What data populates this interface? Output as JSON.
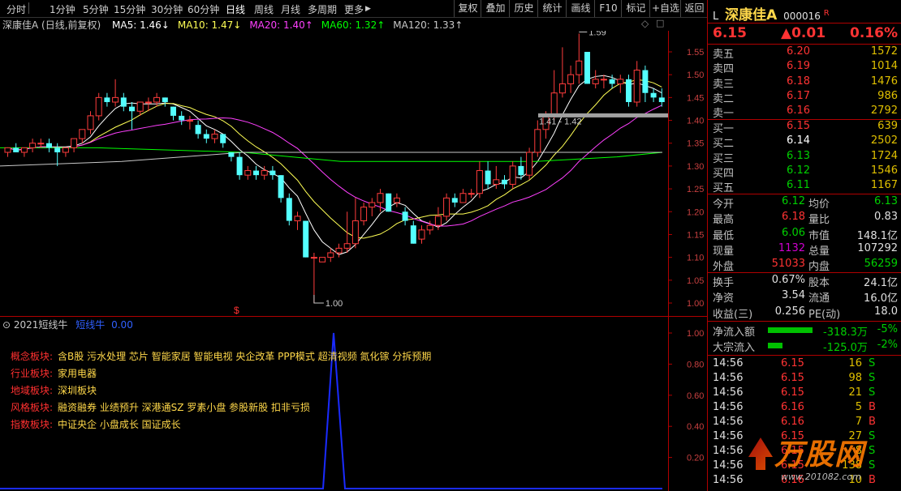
{
  "toolbar": {
    "periods": [
      "分时",
      "1分钟",
      "5分钟",
      "15分钟",
      "30分钟",
      "60分钟",
      "日线",
      "周线",
      "月线",
      "多周期",
      "更多"
    ],
    "active": "日线",
    "more_arrow": "▶",
    "buttons": [
      "复权",
      "叠加",
      "历史",
      "统计",
      "画线",
      "F10",
      "标记",
      "+自选",
      "返回"
    ]
  },
  "chart_header": {
    "title": "深康佳A (日线,前复权)",
    "ma": [
      {
        "label": "MA5: 1.46↓",
        "color": "#ffffff"
      },
      {
        "label": "MA10: 1.47↓",
        "color": "#ffff55"
      },
      {
        "label": "MA20: 1.40↑",
        "color": "#ff40ff"
      },
      {
        "label": "MA60: 1.32↑",
        "color": "#00ff00"
      },
      {
        "label": "MA120: 1.33↑",
        "color": "#c8c8c8"
      }
    ]
  },
  "chart_data": {
    "type": "candlestick",
    "ylim": [
      1.0,
      1.6
    ],
    "y_ticks": [
      "1.55",
      "1.50",
      "1.45",
      "1.40",
      "1.35",
      "1.30",
      "1.25",
      "1.20",
      "1.15",
      "1.10",
      "1.05",
      "1.00"
    ],
    "annotations": {
      "high": "1.59",
      "low": "1.00",
      "range": "1.41 - 1.42"
    },
    "marker": "$"
  },
  "indicator": {
    "title": "2021短线牛",
    "series_name": "短线牛",
    "value": "0.00",
    "y_ticks": [
      "1.00",
      "0.80",
      "0.60",
      "0.40",
      "0.20"
    ]
  },
  "info_lines": [
    {
      "key": "概念板块:",
      "value": "含B股 污水处理 芯片 智能家居 智能电视 央企改革 PPP模式 超清视频 氮化镓 分拆预期"
    },
    {
      "key": "行业板块:",
      "value": "家用电器"
    },
    {
      "key": "地域板块:",
      "value": "深圳板块"
    },
    {
      "key": "风格板块:",
      "value": "融资融券 业绩预升 深港通SZ 罗素小盘 参股新股 扣非亏损"
    },
    {
      "key": "指数板块:",
      "value": "中证央企 小盘成长 国证成长"
    }
  ],
  "quote": {
    "prefix": "L",
    "name": "深康佳A",
    "code": "000016",
    "suffix": "R",
    "price": "6.15",
    "change": "▲0.01",
    "pct": "0.16%",
    "asks": [
      {
        "label": "卖五",
        "price": "6.20",
        "vol": "1572"
      },
      {
        "label": "卖四",
        "price": "6.19",
        "vol": "1014"
      },
      {
        "label": "卖三",
        "price": "6.18",
        "vol": "1476"
      },
      {
        "label": "卖二",
        "price": "6.17",
        "vol": "986"
      },
      {
        "label": "卖一",
        "price": "6.16",
        "vol": "2792"
      }
    ],
    "bids": [
      {
        "label": "买一",
        "price": "6.15",
        "vol": "639"
      },
      {
        "label": "买二",
        "price": "6.14",
        "vol": "2502"
      },
      {
        "label": "买三",
        "price": "6.13",
        "vol": "1724"
      },
      {
        "label": "买四",
        "price": "6.12",
        "vol": "1546"
      },
      {
        "label": "买五",
        "price": "6.11",
        "vol": "1167"
      }
    ],
    "stats": [
      {
        "l1": "今开",
        "v1": "6.12",
        "l2": "均价",
        "v2": "6.13"
      },
      {
        "l1": "最高",
        "v1": "6.18",
        "l2": "量比",
        "v2": "0.83"
      },
      {
        "l1": "最低",
        "v1": "6.06",
        "l2": "市值",
        "v2": "148.1亿"
      },
      {
        "l1": "现量",
        "v1": "1132",
        "l2": "总量",
        "v2": "107292"
      },
      {
        "l1": "外盘",
        "v1": "51033",
        "l2": "内盘",
        "v2": "56259"
      }
    ],
    "stats2": [
      {
        "l1": "换手",
        "v1": "0.67%",
        "l2": "股本",
        "v2": "24.1亿"
      },
      {
        "l1": "净资",
        "v1": "3.54",
        "l2": "流通",
        "v2": "16.0亿"
      },
      {
        "l1": "收益(三)",
        "v1": "0.256",
        "l2": "PE(动)",
        "v2": "18.0"
      }
    ],
    "flows": [
      {
        "label": "净流入额",
        "value": "-318.3万",
        "pct": "-5%",
        "fill": 0.55
      },
      {
        "label": "大宗流入",
        "value": "-125.0万",
        "pct": "-2%",
        "fill": 0.18
      }
    ],
    "ticks": [
      {
        "time": "14:56",
        "price": "6.15",
        "vol": "16",
        "side": "S"
      },
      {
        "time": "14:56",
        "price": "6.15",
        "vol": "98",
        "side": "S"
      },
      {
        "time": "14:56",
        "price": "6.15",
        "vol": "21",
        "side": "S"
      },
      {
        "time": "14:56",
        "price": "6.16",
        "vol": "5",
        "side": "B"
      },
      {
        "time": "14:56",
        "price": "6.16",
        "vol": "7",
        "side": "B"
      },
      {
        "time": "14:56",
        "price": "6.15",
        "vol": "27",
        "side": "S"
      },
      {
        "time": "14:56",
        "price": "6.15",
        "vol": "8",
        "side": "S"
      },
      {
        "time": "14:56",
        "price": "6.15",
        "vol": "138",
        "side": "S"
      },
      {
        "time": "14:56",
        "price": "6.16",
        "vol": "10",
        "side": "B"
      }
    ]
  },
  "watermark": {
    "text": "万股网",
    "url": "www.201082.com"
  }
}
